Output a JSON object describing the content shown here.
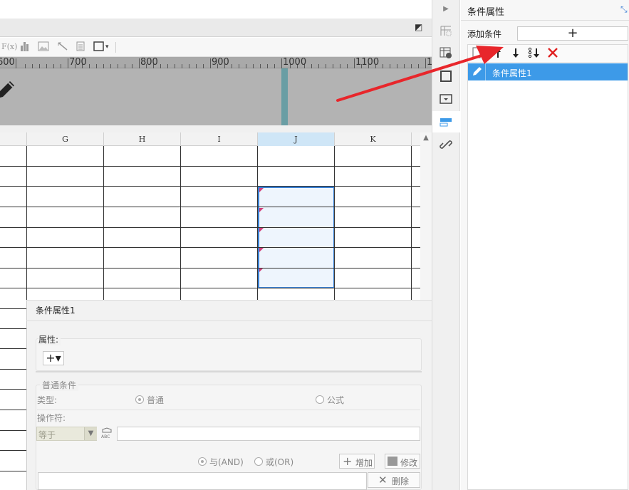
{
  "ruler": {
    "labels": [
      "600",
      "700",
      "800",
      "900",
      "1000",
      "1100",
      "1"
    ]
  },
  "grid": {
    "columns": [
      "G",
      "H",
      "I",
      "J",
      "K"
    ],
    "selected_column": "J"
  },
  "toolbar": {
    "formula_icon_text": "F(x)",
    "dropdown_glyph": "▾"
  },
  "dialog": {
    "title": "条件属性1",
    "attribute_label": "属性:",
    "add_attr_glyph": "+▾",
    "normal_condition_legend": "普通条件",
    "type_label": "类型:",
    "type_normal": "普通",
    "type_formula": "公式",
    "operator_label": "操作符:",
    "operator_value": "等于",
    "abc_icon_text": "ABC",
    "value_input": "",
    "logic_and": "与(AND)",
    "logic_or": "或(OR)",
    "add_button": "增加",
    "modify_button": "修改",
    "delete_button": "删除"
  },
  "panel": {
    "title": "条件属性",
    "add_condition_label": "添加条件",
    "add_glyph": "+",
    "items": [
      {
        "label": "条件属性1",
        "selected": true
      }
    ]
  },
  "colors": {
    "accent": "#3d9ae8",
    "selection_border": "#3b82d6",
    "delete_red": "#e02020",
    "arrow_red": "#e8262b"
  }
}
